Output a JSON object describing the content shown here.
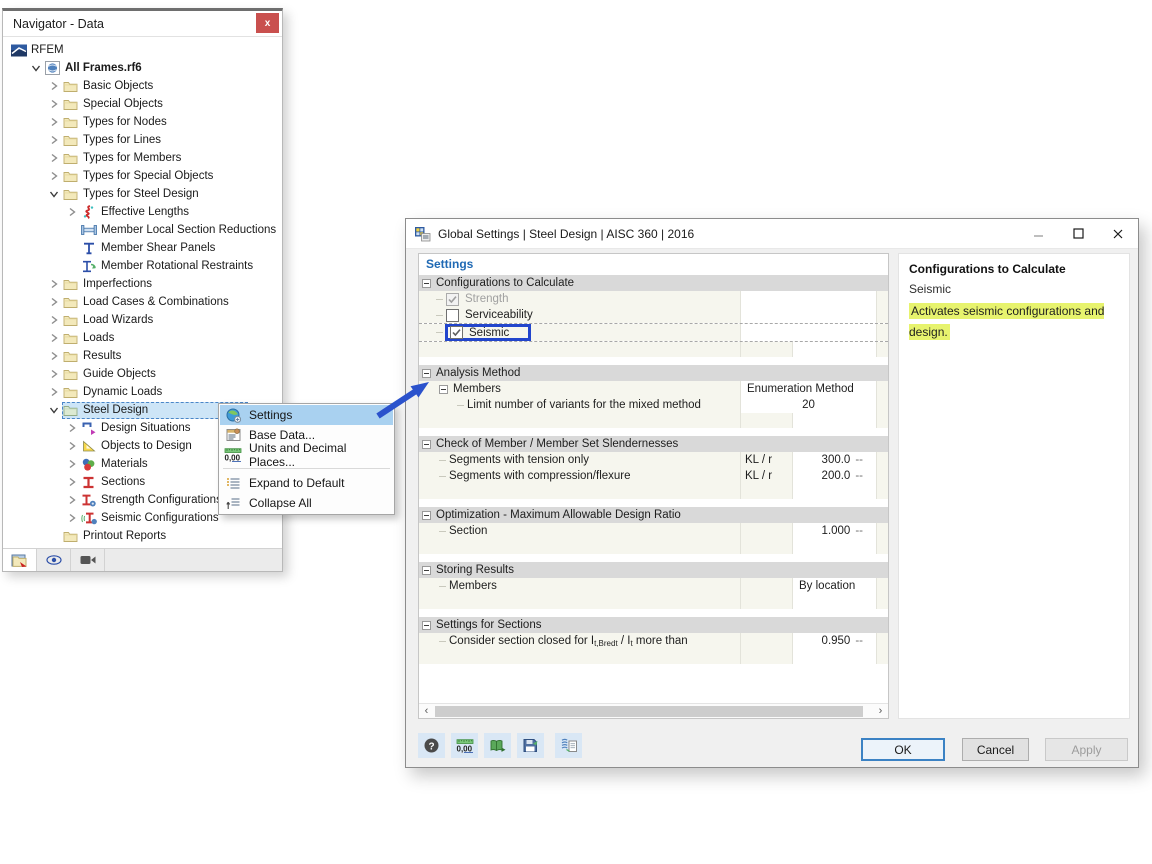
{
  "colors": {
    "menu_highlight": "#a9d1f0",
    "tree_selection": "#cde5f7",
    "annotation_blue": "#2245cc",
    "arrow_blue": "#2b52cc",
    "highlight_yellow": "#e7f36e",
    "close_button_red": "#c9504e",
    "group_row_gray": "#d9d9d9",
    "row_cream": "#f6f6ee"
  },
  "navigator": {
    "title": "Navigator - Data",
    "close_glyph": "x",
    "tree": [
      {
        "label": "RFEM",
        "level": 0,
        "icon": "rfem",
        "chevron": "none"
      },
      {
        "label": "All Frames.rf6",
        "level": 1,
        "icon": "model",
        "chevron": "down",
        "bold": true
      },
      {
        "label": "Basic Objects",
        "level": 2,
        "icon": "folder",
        "chevron": "right"
      },
      {
        "label": "Special Objects",
        "level": 2,
        "icon": "folder",
        "chevron": "right"
      },
      {
        "label": "Types for Nodes",
        "level": 2,
        "icon": "folder",
        "chevron": "right"
      },
      {
        "label": "Types for Lines",
        "level": 2,
        "icon": "folder",
        "chevron": "right"
      },
      {
        "label": "Types for Members",
        "level": 2,
        "icon": "folder",
        "chevron": "right"
      },
      {
        "label": "Types for Special Objects",
        "level": 2,
        "icon": "folder",
        "chevron": "right"
      },
      {
        "label": "Types for Steel Design",
        "level": 2,
        "icon": "folder",
        "chevron": "down"
      },
      {
        "label": "Effective Lengths",
        "level": 3,
        "icon": "effective-lengths",
        "chevron": "right"
      },
      {
        "label": "Member Local Section Reductions",
        "level": 3,
        "icon": "section-reduction",
        "chevron": "none"
      },
      {
        "label": "Member Shear Panels",
        "level": 3,
        "icon": "shear-panel",
        "chevron": "none"
      },
      {
        "label": "Member Rotational Restraints",
        "level": 3,
        "icon": "rotational-restraint",
        "chevron": "none"
      },
      {
        "label": "Imperfections",
        "level": 2,
        "icon": "folder",
        "chevron": "right"
      },
      {
        "label": "Load Cases & Combinations",
        "level": 2,
        "icon": "folder",
        "chevron": "right"
      },
      {
        "label": "Load Wizards",
        "level": 2,
        "icon": "folder",
        "chevron": "right"
      },
      {
        "label": "Loads",
        "level": 2,
        "icon": "folder",
        "chevron": "right"
      },
      {
        "label": "Results",
        "level": 2,
        "icon": "folder",
        "chevron": "right"
      },
      {
        "label": "Guide Objects",
        "level": 2,
        "icon": "folder",
        "chevron": "right"
      },
      {
        "label": "Dynamic Loads",
        "level": 2,
        "icon": "folder",
        "chevron": "right"
      },
      {
        "label": "Steel Design",
        "level": 2,
        "icon": "folder-green",
        "chevron": "down",
        "selected": true
      },
      {
        "label": "Design Situations",
        "level": 3,
        "icon": "design-situations",
        "chevron": "right"
      },
      {
        "label": "Objects to Design",
        "level": 3,
        "icon": "objects-to-design",
        "chevron": "right"
      },
      {
        "label": "Materials",
        "level": 3,
        "icon": "materials",
        "chevron": "right"
      },
      {
        "label": "Sections",
        "level": 3,
        "icon": "sections",
        "chevron": "right"
      },
      {
        "label": "Strength Configurations",
        "level": 3,
        "icon": "strength-config",
        "chevron": "right"
      },
      {
        "label": "Seismic Configurations",
        "level": 3,
        "icon": "seismic-config",
        "chevron": "right"
      },
      {
        "label": "Printout Reports",
        "level": 2,
        "icon": "folder",
        "chevron": "none"
      }
    ],
    "footer_tabs": [
      {
        "name": "data-navigator",
        "icon": "data-tab",
        "selected": true
      },
      {
        "name": "views",
        "icon": "eye",
        "selected": false
      },
      {
        "name": "display",
        "icon": "camera",
        "selected": false
      }
    ]
  },
  "context_menu": {
    "items": [
      {
        "label": "Settings",
        "icon": "settings-menu",
        "highlighted": true
      },
      {
        "label": "Base Data...",
        "icon": "base-data"
      },
      {
        "label": "Units and Decimal Places...",
        "icon": "units"
      },
      {
        "type": "separator"
      },
      {
        "label": "Expand to Default",
        "icon": "expand-default"
      },
      {
        "label": "Collapse All",
        "icon": "collapse-all"
      }
    ]
  },
  "dialog": {
    "title": "Global Settings | Steel Design | AISC 360 | 2016",
    "window_controls": [
      "minimize",
      "maximize",
      "close"
    ],
    "settings_header": "Settings",
    "grid": {
      "groups": [
        {
          "label": "Configurations to Calculate",
          "rows": [
            {
              "type": "checkbox",
              "label": "Strength",
              "state": "checked-disabled"
            },
            {
              "type": "checkbox",
              "label": "Serviceability",
              "state": "unchecked"
            },
            {
              "type": "checkbox",
              "label": "Seismic",
              "state": "checked",
              "annotated": true,
              "focused": true
            },
            {
              "type": "empty"
            }
          ]
        },
        {
          "label": "Analysis Method",
          "rows": [
            {
              "type": "value",
              "label": "Members",
              "expander": true,
              "value": "Enumeration Method",
              "align": "left",
              "merged": true
            },
            {
              "type": "value",
              "label": "Limit number of variants for the mixed method",
              "indent": 2,
              "value": "20",
              "align": "center",
              "merged": true
            },
            {
              "type": "empty"
            }
          ]
        },
        {
          "label": "Check of Member / Member Set Slendernesses",
          "rows": [
            {
              "type": "value",
              "label": "Segments with tension only",
              "indent": 1,
              "sym": "KL / r",
              "value": "300.0",
              "unit": "--",
              "align": "right"
            },
            {
              "type": "value",
              "label": "Segments with compression/flexure",
              "indent": 1,
              "sym": "KL / r",
              "value": "200.0",
              "unit": "--",
              "align": "right"
            },
            {
              "type": "empty"
            }
          ]
        },
        {
          "label": "Optimization - Maximum Allowable Design Ratio",
          "rows": [
            {
              "type": "value",
              "label": "Section",
              "indent": 1,
              "value": "1.000",
              "unit": "--",
              "align": "right"
            },
            {
              "type": "empty"
            }
          ]
        },
        {
          "label": "Storing Results",
          "rows": [
            {
              "type": "value",
              "label": "Members",
              "indent": 1,
              "value": "By location",
              "align": "left"
            },
            {
              "type": "empty"
            }
          ]
        },
        {
          "label": "Settings for Sections",
          "rows": [
            {
              "type": "value",
              "label_segments": [
                {
                  "t": "Consider section closed for I"
                },
                {
                  "t": "t,Bredt",
                  "sub": true
                },
                {
                  "t": " / I"
                },
                {
                  "t": "t",
                  "sub": true
                },
                {
                  "t": " more than"
                }
              ],
              "indent": 1,
              "value": "0.950",
              "unit": "--",
              "align": "right"
            },
            {
              "type": "empty"
            }
          ]
        }
      ]
    },
    "scrollbar": {
      "left": "‹",
      "right": "›"
    },
    "toolbar_icons": [
      "help",
      "units",
      "book-export",
      "save",
      "copy-settings"
    ],
    "right_panel": {
      "title": "Configurations to Calculate",
      "item": "Seismic",
      "description": "Activates seismic configurations and design."
    },
    "buttons": {
      "ok": "OK",
      "cancel": "Cancel",
      "apply": "Apply"
    }
  }
}
